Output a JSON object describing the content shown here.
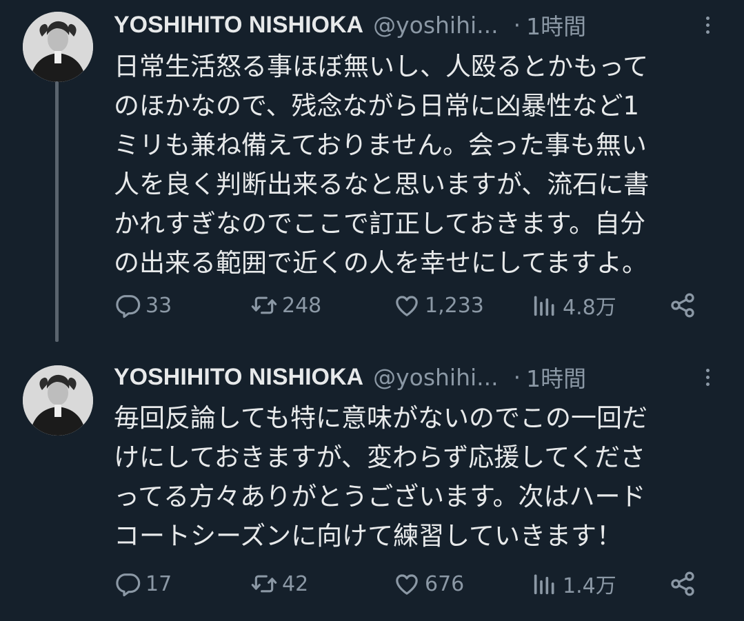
{
  "tweets": [
    {
      "author_name": "YOSHIHITO NISHIOKA",
      "handle": "@yoshihi...",
      "separator": "·",
      "time": "1時間",
      "text": "日常生活怒る事ほぼ無いし、人殴るとかもって\nのほかなので、残念ながら日常に凶暴性など1\nミリも兼ね備えておりません。会った事も無い\n人を良く判断出来るなと思いますが、流石に書\nかれすぎなのでここで訂正しておきます。自分\nの出来る範囲で近くの人を幸せにしてますよ。",
      "replies": "33",
      "retweets": "248",
      "likes": "1,233",
      "views": "4.8万"
    },
    {
      "author_name": "YOSHIHITO NISHIOKA",
      "handle": "@yoshihi...",
      "separator": "·",
      "time": "1時間",
      "text": "毎回反論しても特に意味がないのでこの一回だ\nけにしておきますが、変わらず応援してくださ\nってる方々ありがとうございます。次はハード\nコートシーズンに向けて練習していきます！",
      "replies": "17",
      "retweets": "42",
      "likes": "676",
      "views": "1.4万"
    }
  ],
  "icons": {
    "reply": "reply-icon",
    "retweet": "retweet-icon",
    "like": "heart-icon",
    "views": "views-icon",
    "share": "share-icon",
    "more": "more-icon"
  },
  "colors": {
    "background": "#15202b",
    "text": "#e7e9ea",
    "muted": "#8b98a5"
  }
}
